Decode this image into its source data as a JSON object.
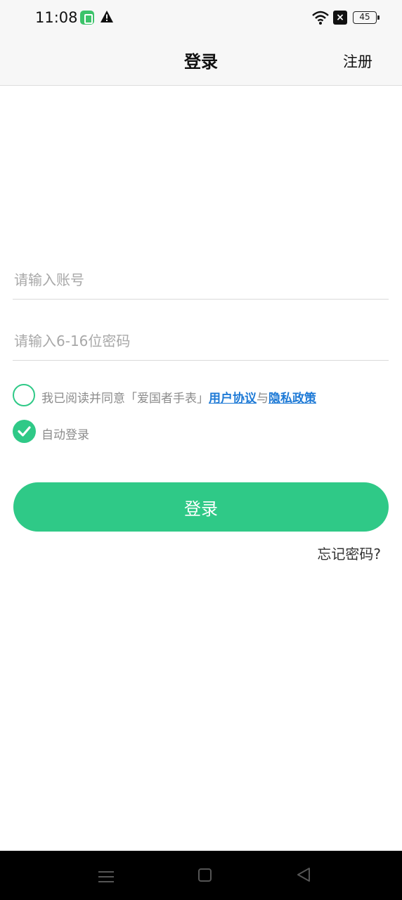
{
  "status_bar": {
    "time": "11:08",
    "battery": "45"
  },
  "header": {
    "title": "登录",
    "register": "注册"
  },
  "form": {
    "account_placeholder": "请输入账号",
    "password_placeholder": "请输入6-16位密码",
    "agree_prefix": "我已阅读并同意「爱国者手表」",
    "agree_user_agreement": "用户协议",
    "agree_and": "与",
    "agree_privacy_policy": "隐私政策",
    "auto_login": "自动登录",
    "login_button": "登录",
    "forgot_password": "忘记密码?"
  },
  "colors": {
    "accent": "#2fc987",
    "link": "#1e7ad6"
  },
  "icons": [
    "app-icon",
    "warning-icon",
    "wifi-icon",
    "x-icon",
    "battery-icon",
    "check-icon",
    "menu-icon",
    "home-icon",
    "back-icon"
  ]
}
